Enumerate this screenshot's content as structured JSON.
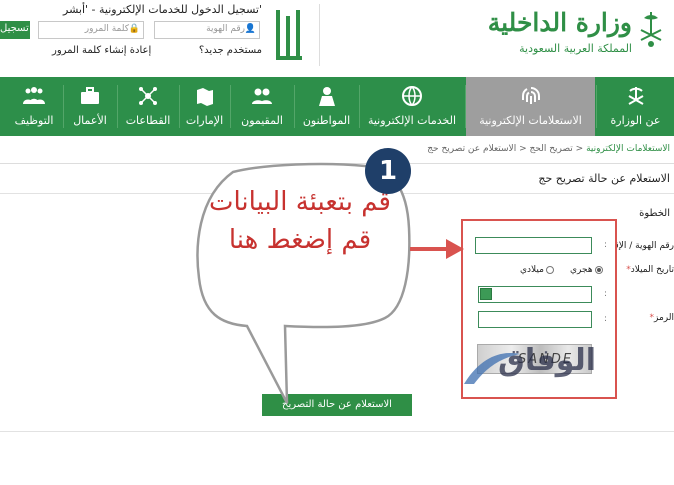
{
  "header": {
    "ministry_title": "وزارة الداخلية",
    "ministry_subtitle": "المملكة العربية السعودية",
    "login_title": "تسجيل الدخول للخدمات الإلكترونية - 'أبشر'",
    "id_placeholder": "رقم الهوية",
    "password_placeholder": "كلمة المرور",
    "login_button": "تسجيل",
    "new_user_link": "مستخدم جديد؟",
    "reset_password_link": "إعادة إنشاء كلمة المرور"
  },
  "nav": {
    "items": [
      {
        "label": "عن الوزارة",
        "icon": "emblem-icon"
      },
      {
        "label": "الاستعلامات الإلكترونية",
        "icon": "fingerprint-icon",
        "active": true
      },
      {
        "label": "الخدمات الإلكترونية",
        "icon": "globe-icon"
      },
      {
        "label": "المواطنون",
        "icon": "person-icon"
      },
      {
        "label": "المقيمون",
        "icon": "people-icon"
      },
      {
        "label": "الإمارات",
        "icon": "map-icon"
      },
      {
        "label": "القطاعات",
        "icon": "network-icon"
      },
      {
        "label": "الأعمال",
        "icon": "briefcase-icon"
      },
      {
        "label": "التوظيف",
        "icon": "group-icon"
      }
    ]
  },
  "breadcrumb": {
    "link": "الاستعلامات الإلكترونية",
    "middle": "تصريح الحج",
    "current": "الاستعلام عن تصريح حج"
  },
  "page_title": "الاستعلام عن حالة تصريح حج",
  "form": {
    "step_label": "الخطوة",
    "id_label": "رقم الهوية / الإقامة",
    "birth_label": "تاريخ الميلاد",
    "hijri_label": "هجري",
    "gregorian_label": "ميلادي",
    "captcha_label": "الرمز",
    "captcha_text": "SANDE",
    "submit_button": "الاستعلام عن حالة التصريح"
  },
  "annotation": {
    "step_number": "1",
    "callout_text": "قم بتعبئة البيانات قم إضغط هنا"
  },
  "watermark": "الوفاق",
  "colors": {
    "brand_green": "#2d8f4a",
    "active_gray": "#9e9e9e",
    "callout_red": "#c7322f",
    "badge_navy": "#1f3f69"
  }
}
